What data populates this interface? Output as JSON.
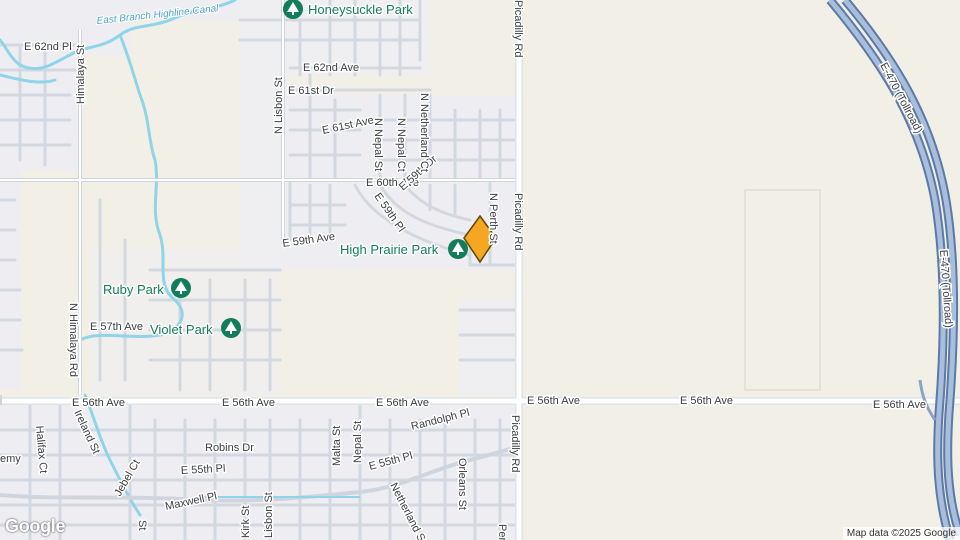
{
  "map": {
    "attribution": "Map data ©2025 Google",
    "logo": "Google",
    "colors": {
      "land": "#f2efe6",
      "residential": "#eeeef2",
      "road": "#ffffff",
      "road_casing": "#cfd5de",
      "arterial": "#dde3ea",
      "highway": "#8aa4c6",
      "highway_dark": "#5b7aa5",
      "water": "#8fd4e8",
      "park": "#137d5b",
      "marker": "#f5a623"
    },
    "marker": {
      "name": "location-marker"
    },
    "labels": {
      "canal": "East Branch Highline Canal",
      "honeysuckle_park": "Honeysuckle Park",
      "high_prairie_park": "High Prairie Park",
      "ruby_park": "Ruby Park",
      "violet_park": "Violet Park",
      "e62nd_pl": "E 62nd Pl",
      "e62nd_ave": "E 62nd Ave",
      "e61st_dr": "E 61st Dr",
      "e61st_ave": "E 61st Ave",
      "e60th_ave": "E 60th Ave",
      "e59th_ave": "E 59th Ave",
      "e59th_dr": "E 59th Dr",
      "e59th_pl": "E 59th Pl",
      "e57th_ave": "E 57th Ave",
      "e56th_ave": "E 56th Ave",
      "e55th_pl": "E 55th Pl",
      "e55th_pl_b": "E 55th Pl",
      "n_lisbon_st": "N Lisbon St",
      "n_nepal_st": "N Nepal St",
      "n_nepal_ct": "N Nepal Ct",
      "n_netherland_ct": "N Netherland Ct",
      "n_perth_st": "N Perth St",
      "picadilly_rd": "Picadilly Rd",
      "himalaya_st": "Himalaya St",
      "n_himalaya_rd": "N Himalaya Rd",
      "ireland_st": "Ireland St",
      "halifax_ct": "Halifax Ct",
      "jebel_ct": "Jebel Ct",
      "maxwell_pl": "Maxwell Pl",
      "kirk_st": "Kirk St",
      "lisbon_st": "Lisbon St",
      "robins_dr": "Robins Dr",
      "malta_st": "Malta St",
      "nepal_st": "Nepal St",
      "randolph_pl": "Randolph Pl",
      "netherland_st": "Netherland St",
      "orleans_st": "Orleans St",
      "e470": "E-470 (Tollroad)",
      "academy": "emy",
      "s_fragment": "St",
      "per_fragment": "Per"
    }
  }
}
